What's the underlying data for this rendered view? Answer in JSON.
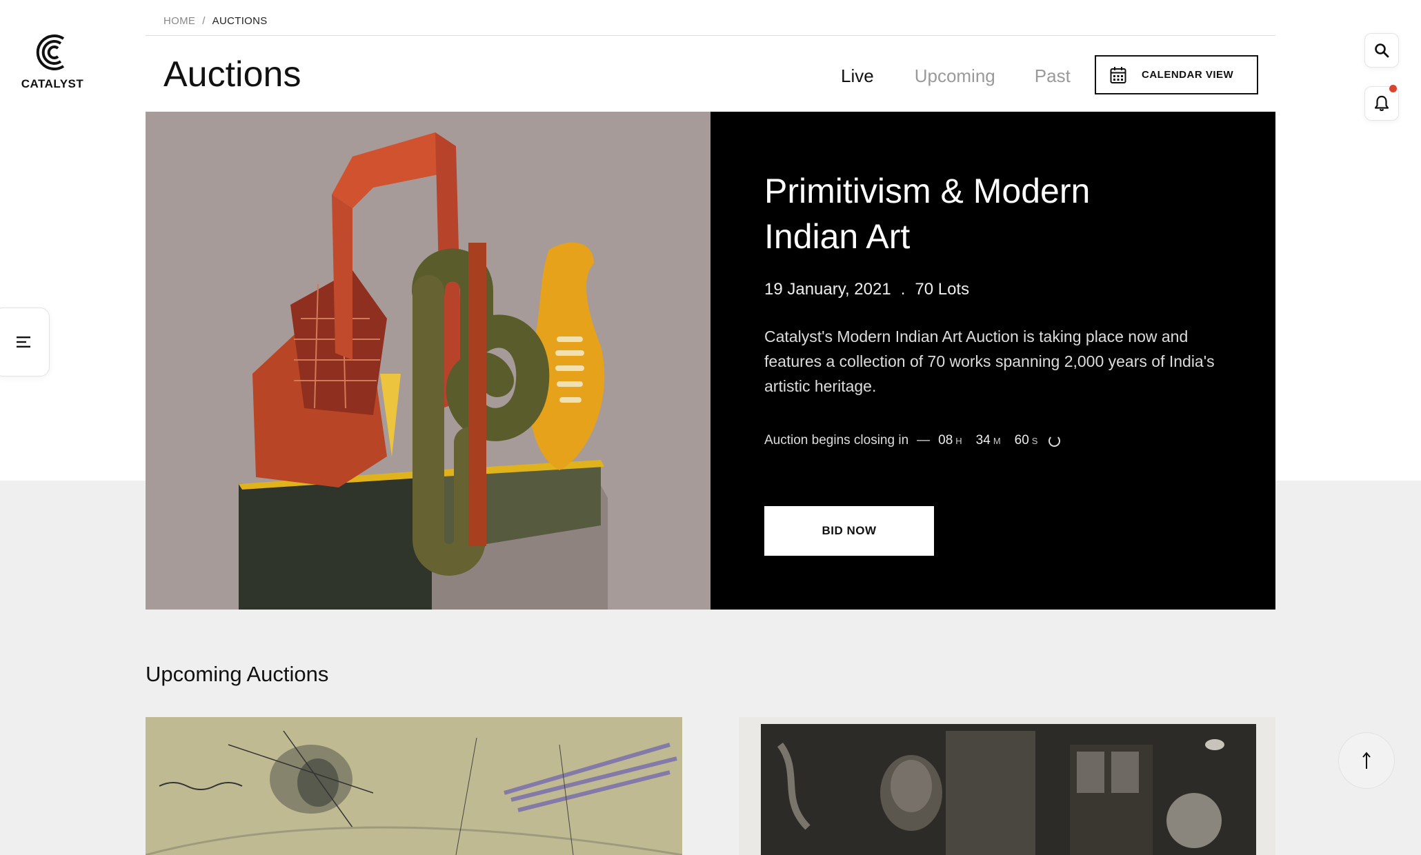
{
  "brand": {
    "name": "CATALYST"
  },
  "breadcrumb": {
    "home": "HOME",
    "separator": "/",
    "current": "AUCTIONS"
  },
  "page": {
    "title": "Auctions"
  },
  "tabs": [
    {
      "label": "Live",
      "active": true
    },
    {
      "label": "Upcoming",
      "active": false
    },
    {
      "label": "Past",
      "active": false
    }
  ],
  "calendar_button": {
    "label": "CALENDAR VIEW",
    "icon": "calendar-icon"
  },
  "rail": {
    "search_icon": "search-icon",
    "bell_icon": "bell-icon",
    "has_notification": true,
    "notification_color": "#d9432f"
  },
  "hero": {
    "title": "Primitivism & Modern Indian Art",
    "date": "19 January, 2021",
    "meta_separator": ".",
    "lots": "70 Lots",
    "description": "Catalyst's Modern Indian Art Auction is taking place now and features a collection of 70 works spanning 2,000 years of India's artistic heritage.",
    "countdown": {
      "label": "Auction begins closing in",
      "dash": "—",
      "hours": "08",
      "hours_unit": "H",
      "minutes": "34",
      "minutes_unit": "M",
      "seconds": "60",
      "seconds_unit": "S"
    },
    "bid_button": "BID NOW"
  },
  "upcoming": {
    "heading": "Upcoming Auctions"
  },
  "colors": {
    "hero_panel": "#000000",
    "page_bg_lower": "#efefef",
    "accent_red": "#d9432f"
  }
}
